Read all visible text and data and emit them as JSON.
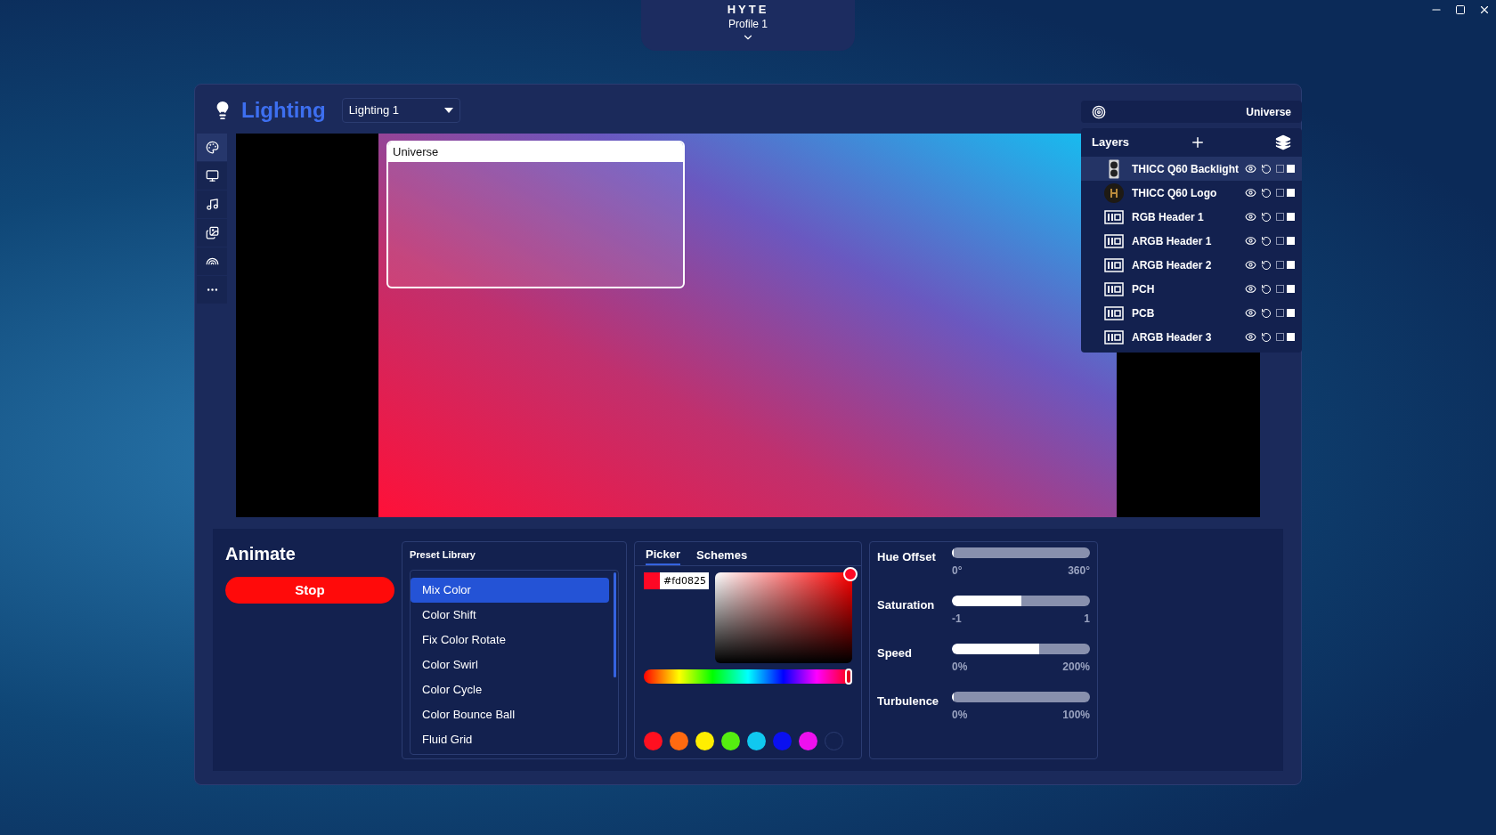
{
  "app": {
    "logo": "HYTE",
    "profile": "Profile 1"
  },
  "header": {
    "title": "Lighting",
    "dropdown": "Lighting 1"
  },
  "sidebar": [
    {
      "selected": true
    },
    {
      "selected": false
    },
    {
      "selected": false
    },
    {
      "selected": false
    },
    {
      "selected": false
    },
    {
      "selected": false
    }
  ],
  "canvas": {
    "zone_label": "Universe"
  },
  "target_bar": {
    "label": "Universe"
  },
  "layers": {
    "title": "Layers",
    "items": [
      {
        "name": "THICC Q60 Backlight",
        "kind": "backlight",
        "selected": true
      },
      {
        "name": "THICC Q60 Logo",
        "kind": "logo",
        "selected": false
      },
      {
        "name": "RGB Header 1",
        "kind": "header",
        "selected": false
      },
      {
        "name": "ARGB Header 1",
        "kind": "header",
        "selected": false
      },
      {
        "name": "ARGB Header 2",
        "kind": "header",
        "selected": false
      },
      {
        "name": "PCH",
        "kind": "header",
        "selected": false
      },
      {
        "name": "PCB",
        "kind": "header",
        "selected": false
      },
      {
        "name": "ARGB Header 3",
        "kind": "header",
        "selected": false
      }
    ]
  },
  "animate": {
    "title": "Animate",
    "button": "Stop"
  },
  "preset_library": {
    "title": "Preset Library",
    "items": [
      {
        "label": "Mix Color",
        "selected": true
      },
      {
        "label": "Color Shift",
        "selected": false
      },
      {
        "label": "Fix Color Rotate",
        "selected": false
      },
      {
        "label": "Color Swirl",
        "selected": false
      },
      {
        "label": "Color Cycle",
        "selected": false
      },
      {
        "label": "Color Bounce Ball",
        "selected": false
      },
      {
        "label": "Fluid Grid",
        "selected": false
      }
    ]
  },
  "color_picker": {
    "tabs": [
      {
        "label": "Picker",
        "selected": true
      },
      {
        "label": "Schemes",
        "selected": false
      }
    ],
    "hex": "#fd0825",
    "color": "#fd0825",
    "hue": {
      "level": 1
    },
    "swatches": [
      {
        "kind": "color",
        "color": "#ff1020"
      },
      {
        "kind": "color",
        "color": "#ff6a10"
      },
      {
        "kind": "color",
        "color": "#ffee00"
      },
      {
        "kind": "color",
        "color": "#55ee10"
      },
      {
        "kind": "color",
        "color": "#10c8f0"
      },
      {
        "kind": "color",
        "color": "#0a10f0"
      },
      {
        "kind": "color",
        "color": "#ee10ee"
      },
      {
        "kind": "empty"
      }
    ]
  },
  "sliders": [
    {
      "label": "Hue Offset",
      "level": 0,
      "min": "0°",
      "max": "360°"
    },
    {
      "label": "Saturation",
      "level": 0.5,
      "min": "-1",
      "max": "1"
    },
    {
      "label": "Speed",
      "level": 0.63,
      "min": "0%",
      "max": "200%"
    },
    {
      "label": "Turbulence",
      "level": 0,
      "min": "0%",
      "max": "100%"
    }
  ]
}
